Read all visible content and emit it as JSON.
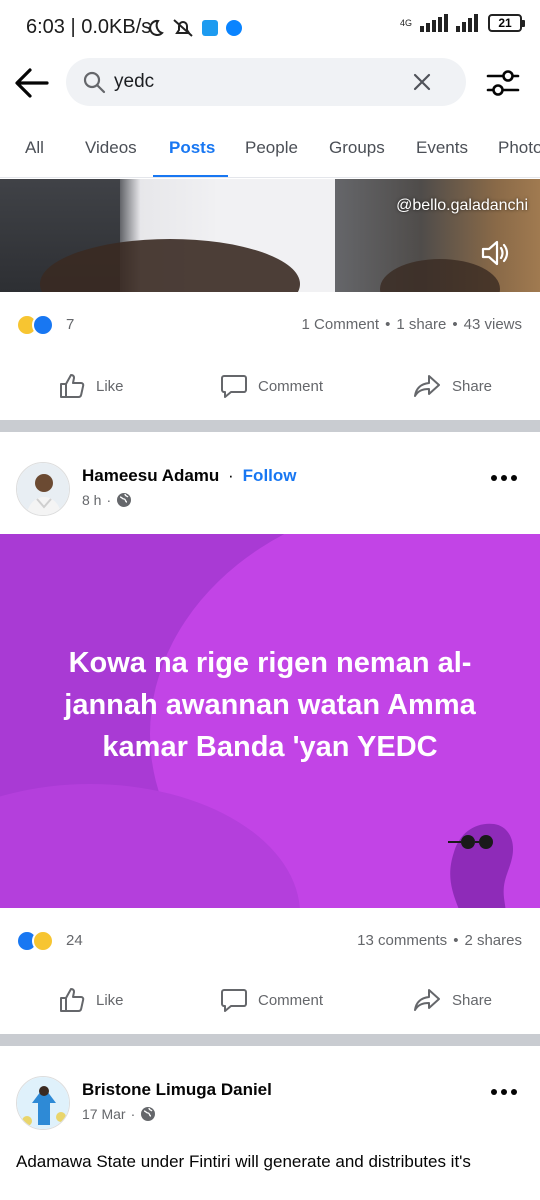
{
  "status_bar": {
    "time": "6:03 | 0.0KB/s",
    "network": "4G",
    "battery": "21"
  },
  "search": {
    "query": "yedc"
  },
  "tabs": [
    {
      "label": "All"
    },
    {
      "label": "Videos"
    },
    {
      "label": "Posts"
    },
    {
      "label": "People"
    },
    {
      "label": "Groups"
    },
    {
      "label": "Events"
    },
    {
      "label": "Photo"
    }
  ],
  "post1": {
    "tiktok_handle": "@bello.galadanchi",
    "reaction_count": "7",
    "comments": "1 Comment",
    "shares": "1 share",
    "views": "43 views",
    "like_label": "Like",
    "comment_label": "Comment",
    "share_label": "Share"
  },
  "post2": {
    "author": "Hameesu Adamu",
    "follow_label": "Follow",
    "time": "8 h",
    "status_text": "Kowa na rige rigen neman al-jannah awannan watan Amma kamar Banda 'yan YEDC",
    "background_color": "#a93ad4",
    "reaction_count": "24",
    "comments": "13 comments",
    "shares": "2 shares",
    "like_label": "Like",
    "comment_label": "Comment",
    "share_label": "Share"
  },
  "post3": {
    "author": "Bristone Limuga Daniel",
    "time": "17 Mar",
    "text": "Adamawa State under Fintiri will generate and distributes it's"
  },
  "colors": {
    "accent": "#1877f2",
    "secondary_text": "#65676b",
    "separator": "#c9ccd1"
  }
}
